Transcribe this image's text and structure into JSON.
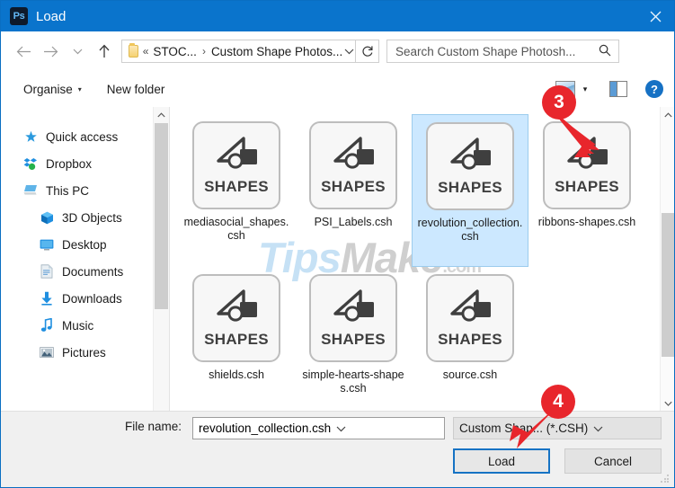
{
  "window": {
    "title": "Load",
    "app_icon": "photoshop-icon",
    "app_icon_text": "Ps",
    "close_icon": "close-icon"
  },
  "navbar": {
    "back_icon": "back-arrow-icon",
    "forward_icon": "forward-arrow-icon",
    "history_icon": "chevron-down-icon",
    "up_icon": "up-arrow-icon",
    "address": {
      "folder_icon": "folder-icon",
      "overflow": "«",
      "crumbs": [
        "STOC...",
        "Custom Shape Photos..."
      ],
      "separator": "›",
      "dropdown_icon": "chevron-down-icon"
    },
    "refresh_icon": "refresh-icon",
    "search": {
      "placeholder": "Search Custom Shape Photosh...",
      "icon": "search-icon"
    }
  },
  "commandbar": {
    "organise": "Organise",
    "organise_caret": "▾",
    "new_folder": "New folder",
    "view_icon": "view-layout-icon",
    "view_caret": "▾",
    "preview_pane_icon": "preview-pane-icon",
    "help_icon": "help-icon",
    "help_glyph": "?"
  },
  "sidebar": {
    "items": [
      {
        "label": "Quick access",
        "icon": "star-pin-icon",
        "level": 0
      },
      {
        "label": "Dropbox",
        "icon": "dropbox-icon",
        "level": 0
      },
      {
        "label": "This PC",
        "icon": "this-pc-icon",
        "level": 0
      },
      {
        "label": "3D Objects",
        "icon": "3d-objects-icon",
        "level": 1
      },
      {
        "label": "Desktop",
        "icon": "desktop-icon",
        "level": 1
      },
      {
        "label": "Documents",
        "icon": "documents-icon",
        "level": 1
      },
      {
        "label": "Downloads",
        "icon": "downloads-icon",
        "level": 1
      },
      {
        "label": "Music",
        "icon": "music-icon",
        "level": 1
      },
      {
        "label": "Pictures",
        "icon": "pictures-icon",
        "level": 1
      }
    ],
    "scroll_up_icon": "chevron-up-icon"
  },
  "files": {
    "thumb_caption": "SHAPES",
    "items": [
      {
        "name": "mediasocial_shapes.csh",
        "selected": false
      },
      {
        "name": "PSI_Labels.csh",
        "selected": false
      },
      {
        "name": "revolution_collection.csh",
        "selected": true
      },
      {
        "name": "ribbons-shapes.csh",
        "selected": false
      },
      {
        "name": "shields.csh",
        "selected": false
      },
      {
        "name": "simple-hearts-shapes.csh",
        "selected": false
      },
      {
        "name": "source.csh",
        "selected": false
      }
    ],
    "scroll_up_icon": "chevron-up-icon",
    "scroll_down_icon": "chevron-down-icon"
  },
  "watermark": {
    "part1": "Tips",
    "part2": "Make",
    "part3": ".com"
  },
  "footer": {
    "filename_label": "File name:",
    "filename_value": "revolution_collection.csh",
    "filename_caret": "⌄",
    "filetype_value": "Custom Shap... (*.CSH)",
    "filetype_caret": "⌄",
    "load_button": "Load",
    "cancel_button": "Cancel"
  },
  "annotations": [
    {
      "number": "3",
      "target": "selected-file-item"
    },
    {
      "number": "4",
      "target": "load-button"
    }
  ],
  "colors": {
    "titlebar": "#0a74cc",
    "accent": "#1673c4",
    "selection": "#cce8ff",
    "annotation": "#e8262c"
  }
}
